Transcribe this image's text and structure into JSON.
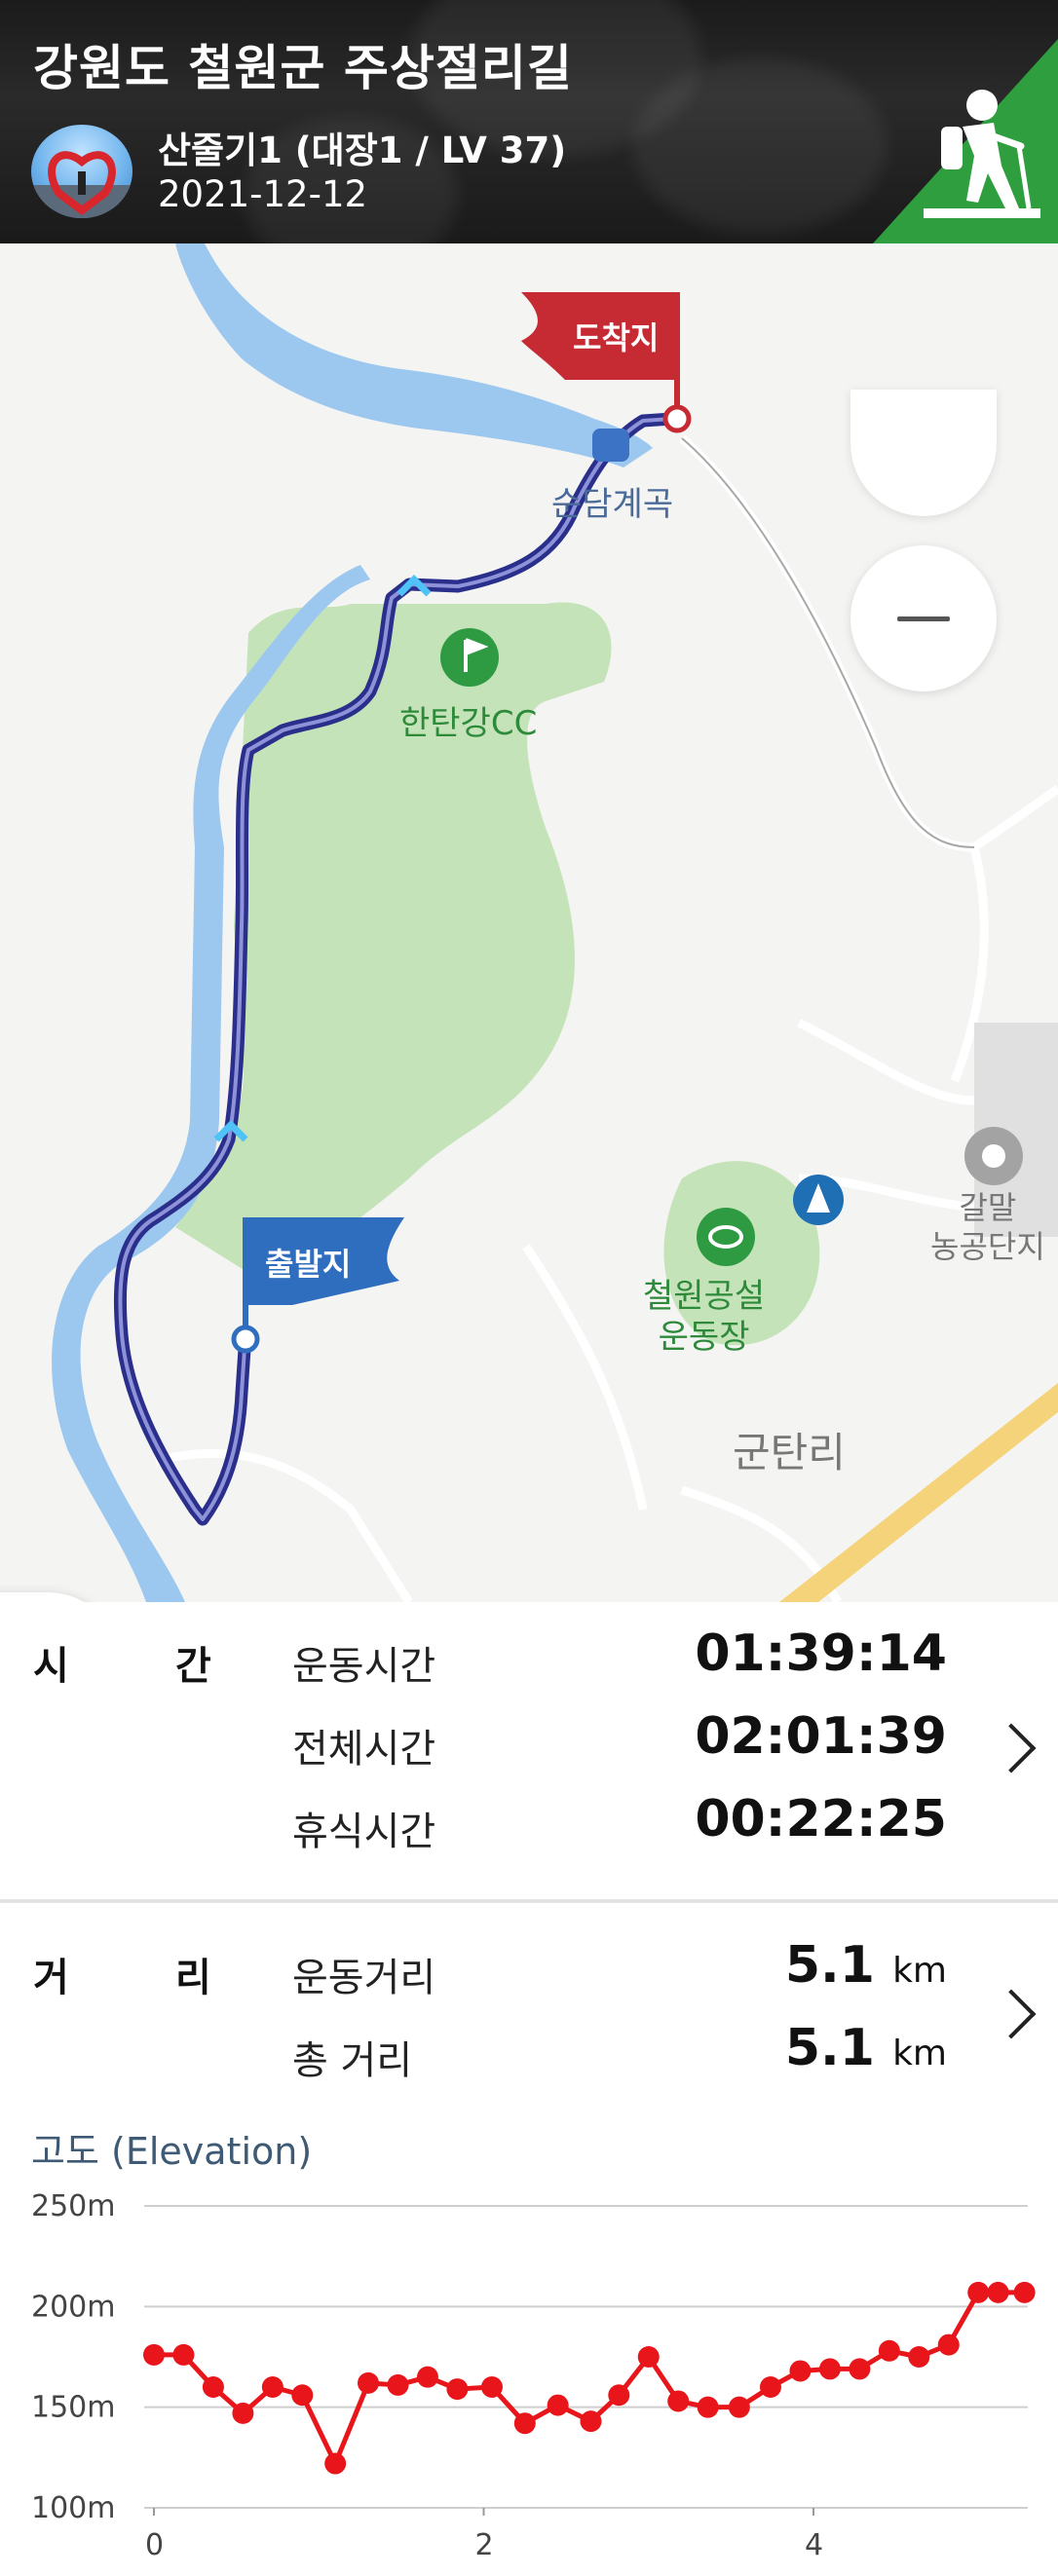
{
  "header": {
    "title": "강원도 철원군 주상절리길",
    "user": "산줄기1 (대장1 / LV 37)",
    "date": "2021-12-12"
  },
  "map": {
    "flags": {
      "end": "도착지",
      "start": "출발지"
    },
    "places": {
      "sundam": "순담계곡",
      "hantan": "한탄강CC",
      "stadium": "철원공설\n운동장",
      "galmal": "갈말\n농공단지",
      "guntan": "군탄리"
    },
    "colors": {
      "track": "#2b2f8c",
      "end_flag": "#c62a32",
      "start_flag": "#2f6dbf",
      "river": "#9cc8f0",
      "park": "#c5e3b8"
    }
  },
  "stats": {
    "time": {
      "label_1": "시",
      "label_2": "간",
      "items": [
        {
          "label": "운동시간",
          "value": "01:39:14"
        },
        {
          "label": "전체시간",
          "value": "02:01:39"
        },
        {
          "label": "휴식시간",
          "value": "00:22:25"
        }
      ]
    },
    "distance": {
      "label_1": "거",
      "label_2": "리",
      "items": [
        {
          "label": "운동거리",
          "value": "5.1",
          "unit": "km"
        },
        {
          "label": "총 거리",
          "value": "5.1",
          "unit": "km"
        }
      ]
    }
  },
  "chart_data": {
    "type": "line",
    "title": "고도 (Elevation)",
    "y_ticks": [
      "250m",
      "200m",
      "150m",
      "100m"
    ],
    "x_ticks": [
      "0",
      "2",
      "4"
    ],
    "xlim": [
      0,
      5.3
    ],
    "ylim": [
      100,
      250
    ],
    "grid": true,
    "series": [
      {
        "color": "#e8161b",
        "x": [
          0,
          0.18,
          0.36,
          0.54,
          0.72,
          0.9,
          1.1,
          1.3,
          1.48,
          1.66,
          1.84,
          2.05,
          2.25,
          2.45,
          2.65,
          2.82,
          3.0,
          3.18,
          3.36,
          3.55,
          3.74,
          3.92,
          4.1,
          4.28,
          4.46,
          4.64,
          4.82,
          5.0,
          5.12,
          5.28
        ],
        "y": [
          176,
          176,
          160,
          147,
          160,
          156,
          122,
          162,
          161,
          165,
          159,
          160,
          142,
          151,
          143,
          156,
          175,
          153,
          150,
          150,
          160,
          168,
          169,
          169,
          178,
          175,
          181,
          207,
          207,
          207
        ]
      }
    ]
  }
}
